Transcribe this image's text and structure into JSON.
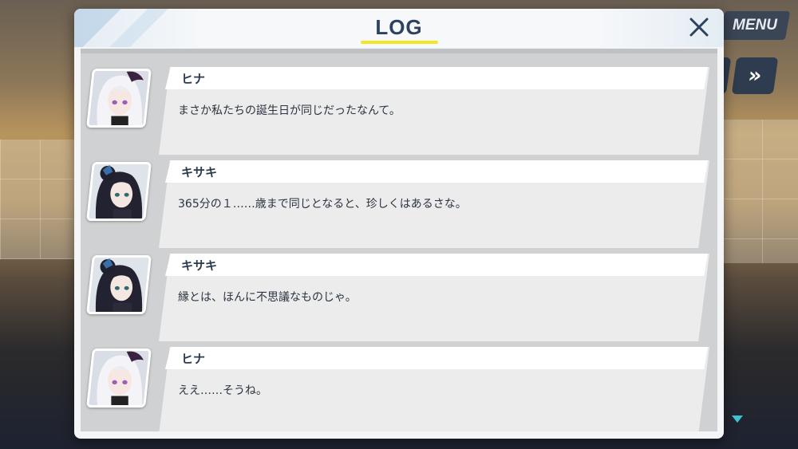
{
  "hud": {
    "menu_label": "MENU",
    "skip_symbol": "»"
  },
  "log": {
    "title": "LOG",
    "close_symbol": "×",
    "entries": [
      {
        "speaker": "ヒナ",
        "portrait": "hina-portrait",
        "text": "まさか私たちの誕生日が同じだったなんて。"
      },
      {
        "speaker": "キサキ",
        "portrait": "kisaki-portrait",
        "text": "365分の１……歳まで同じとなると、珍しくはあるさな。"
      },
      {
        "speaker": "キサキ",
        "portrait": "kisaki-portrait",
        "text": "縁とは、ほんに不思議なものじゃ。"
      },
      {
        "speaker": "ヒナ",
        "portrait": "hina-portrait",
        "text": "ええ……そうね。"
      }
    ]
  },
  "colors": {
    "title": "#2d4260",
    "accent_underline": "#f4e52a",
    "scroll_arrow": "#3fc3d4"
  }
}
